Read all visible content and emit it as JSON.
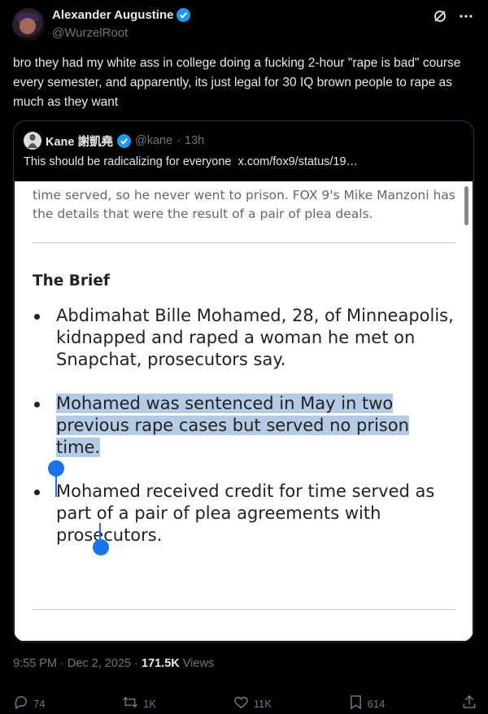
{
  "author": {
    "name": "Alexander Augustine",
    "handle": "@WurzelRoot"
  },
  "tweet_text": "bro they had my white ass in college doing a fucking 2-hour \"rape is bad\" course every semester, and apparently, its just legal for 30 IQ brown people to rape as much as they want",
  "quote": {
    "name": "Kane 謝凱堯",
    "handle": "@kane",
    "time": "13h",
    "text": "This should be radicalizing for everyone",
    "link": "x.com/fox9/status/19…",
    "article": {
      "intro": "time served, so he never went to prison. FOX 9's Mike Manzoni has the details that were the result of a pair of plea deals.",
      "heading": "The Brief",
      "bullets": [
        "Abdimahat Bille Mohamed, 28, of Minneapolis, kidnapped and raped a woman he met on Snapchat, prosecutors say.",
        "Mohamed was sentenced in May in two previous rape cases but served no prison time.",
        "Mohamed received credit for time served as part of a pair of plea agreements with prosecutors."
      ]
    }
  },
  "timestamp": {
    "time": "9:55 PM · Dec 2, 2025 ·",
    "views_count": "171.5K",
    "views_label": "Views"
  },
  "actions": {
    "replies": "74",
    "reposts": "1K",
    "likes": "11K",
    "bookmarks": "614"
  },
  "colors": {
    "background": "#000000",
    "verified": "#1d9bf0",
    "highlight": "#b4cbe6",
    "selection_handle": "#1a73e8"
  }
}
